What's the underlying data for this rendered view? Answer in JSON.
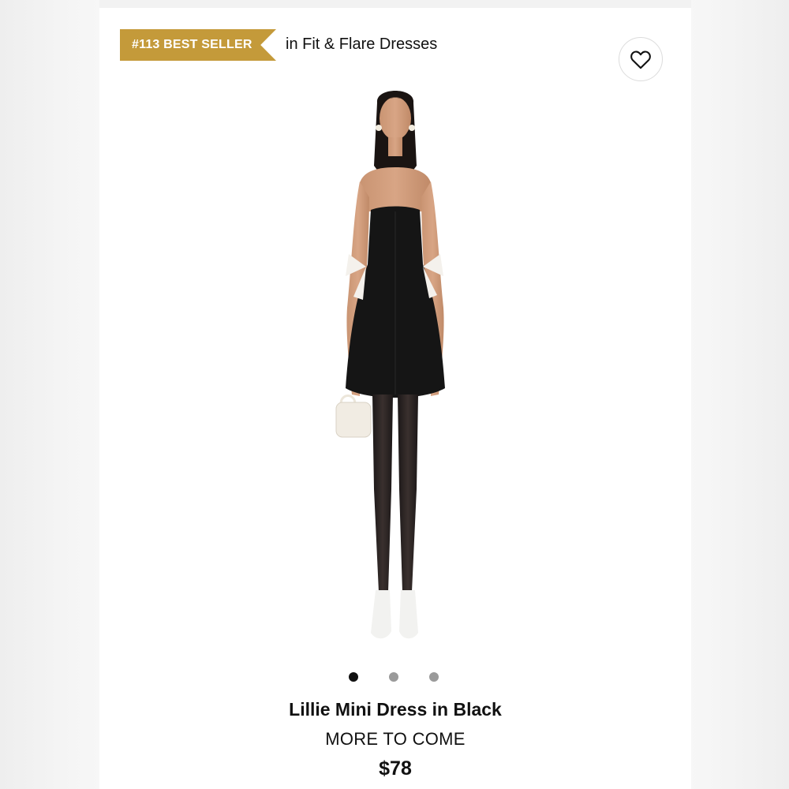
{
  "badge": {
    "label": "#113 BEST SELLER",
    "category": "in Fit & Flare Dresses",
    "color": "#c49a3a"
  },
  "wishlist": {
    "icon": "heart-outline-icon"
  },
  "carousel": {
    "count": 3,
    "active_index": 0
  },
  "product": {
    "name": "Lillie Mini Dress in Black",
    "brand": "MORE TO COME",
    "price": "$78"
  }
}
